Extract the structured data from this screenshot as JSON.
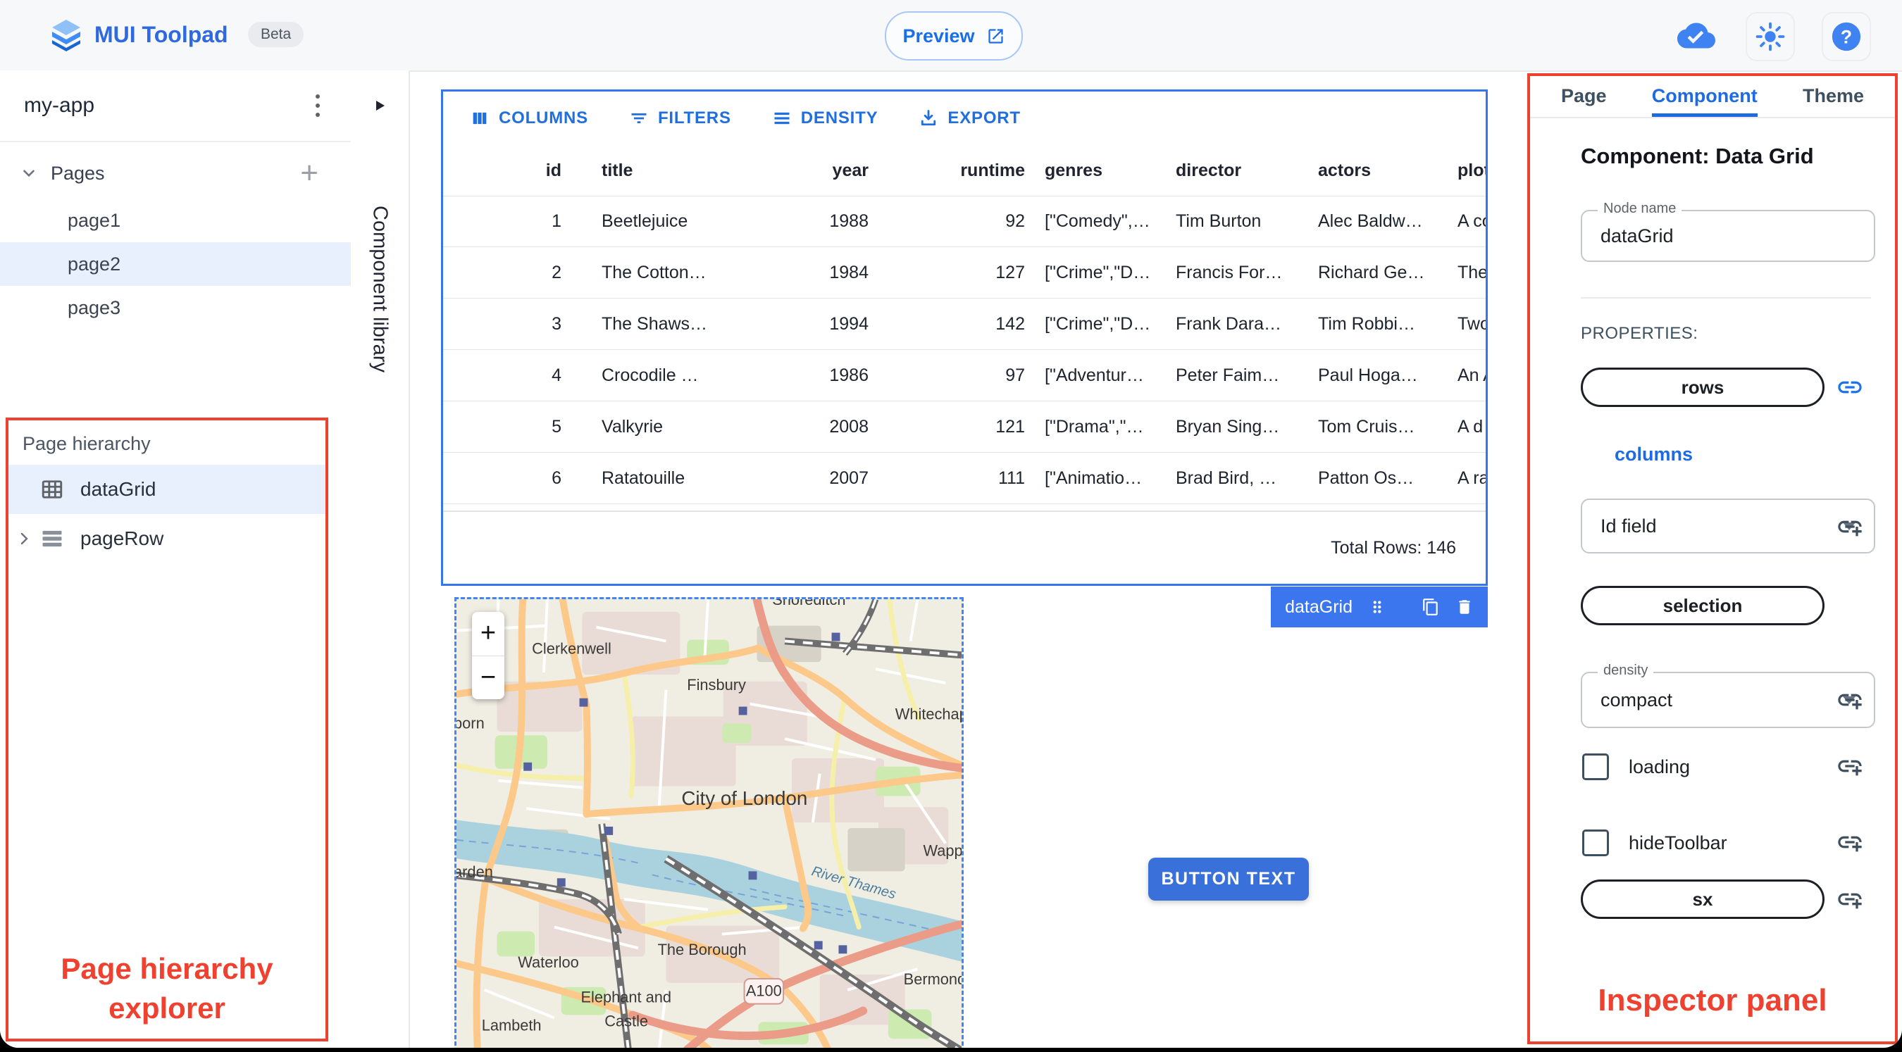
{
  "top_bar": {
    "app_name": "MUI Toolpad",
    "beta_label": "Beta",
    "preview_label": "Preview"
  },
  "sidebar": {
    "project_name": "my-app",
    "pages_section_label": "Pages",
    "pages": [
      "page1",
      "page2",
      "page3"
    ],
    "selected_page": "page2"
  },
  "component_library": {
    "label": "Component library"
  },
  "page_hierarchy": {
    "title": "Page hierarchy",
    "items": [
      {
        "label": "dataGrid",
        "icon": "data-grid"
      },
      {
        "label": "pageRow",
        "icon": "page-row"
      }
    ]
  },
  "canvas": {
    "data_grid": {
      "toolbar": {
        "columns": "COLUMNS",
        "filters": "FILTERS",
        "density": "DENSITY",
        "export": "EXPORT"
      },
      "columns": [
        "id",
        "title",
        "year",
        "runtime",
        "genres",
        "director",
        "actors",
        "plot"
      ],
      "rows": [
        [
          "1",
          "Beetlejuice",
          "1988",
          "92",
          "[\"Comedy\",…",
          "Tim Burton",
          "Alec Baldw…",
          "A co"
        ],
        [
          "2",
          "The Cotton…",
          "1984",
          "127",
          "[\"Crime\",\"D…",
          "Francis For…",
          "Richard Ge…",
          "The"
        ],
        [
          "3",
          "The Shaws…",
          "1994",
          "142",
          "[\"Crime\",\"D…",
          "Frank Dara…",
          "Tim Robbi…",
          "Two"
        ],
        [
          "4",
          "Crocodile …",
          "1986",
          "97",
          "[\"Adventur…",
          "Peter Faim…",
          "Paul Hoga…",
          "An A"
        ],
        [
          "5",
          "Valkyrie",
          "2008",
          "121",
          "[\"Drama\",\"…",
          "Bryan Sing…",
          "Tom Cruis…",
          "A d"
        ],
        [
          "6",
          "Ratatouille",
          "2007",
          "111",
          "[\"Animatio…",
          "Brad Bird, …",
          "Patton Os…",
          "A ra"
        ]
      ],
      "footer_total": "Total Rows: 146",
      "selection_chip_label": "dataGrid"
    },
    "button_label": "BUTTON TEXT",
    "map": {
      "zoom_in": "+",
      "zoom_out": "−",
      "labels": {
        "shoreditch": "Shoreditch",
        "clerkenwell": "Clerkenwell",
        "finsbury": "Finsbury",
        "whitechapel": "Whitechapel",
        "city_of_london": "City of London",
        "holborn_cut": "born",
        "garden_cut": "arden",
        "waterloo": "Waterloo",
        "the_borough": "The Borough",
        "lambeth": "Lambeth",
        "elephant_line1": "Elephant and",
        "elephant_line2": "Castle",
        "bermondsey_cut": "Bermondse",
        "wapping_cut": "Wapping",
        "river_thames": "River Thames",
        "a100": "A100"
      }
    }
  },
  "inspector": {
    "tabs": [
      "Page",
      "Component",
      "Theme"
    ],
    "active_tab": "Component",
    "heading": "Component: Data Grid",
    "node_name_field": {
      "label": "Node name",
      "value": "dataGrid"
    },
    "properties_label": "PROPERTIES:",
    "rows_button": "rows",
    "columns_link": "columns",
    "id_field_select": {
      "value": "Id field"
    },
    "selection_button": "selection",
    "density_select": {
      "label": "density",
      "value": "compact"
    },
    "loading_checkbox": {
      "label": "loading",
      "checked": false
    },
    "hide_toolbar_checkbox": {
      "label": "hideToolbar",
      "checked": false
    },
    "sx_button": "sx"
  },
  "annotations": {
    "page_hierarchy_line1": "Page hierarchy",
    "page_hierarchy_line2": "explorer",
    "inspector_label": "Inspector panel",
    "annotation_color": "#ef4130"
  },
  "colors": {
    "selection_blue": "#3576ef",
    "toolbar_blue": "#1f6fe0",
    "selected_row_bg": "#e9f0fd",
    "chip_blue": "#3b76ef"
  }
}
